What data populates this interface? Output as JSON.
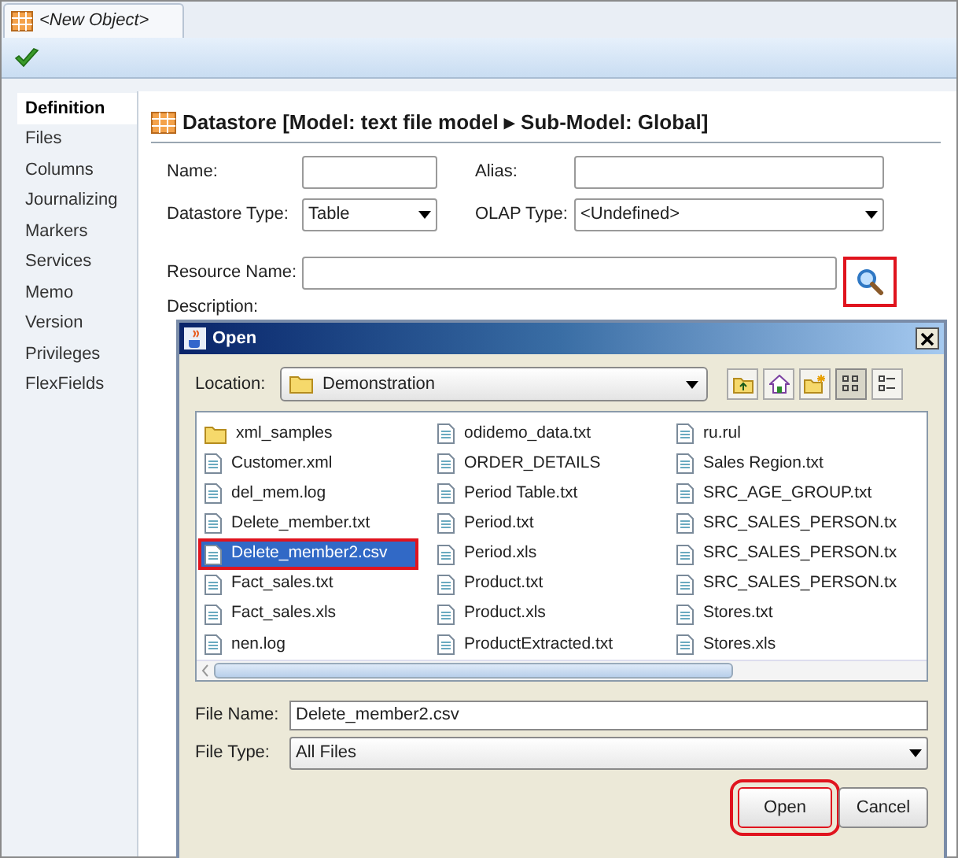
{
  "editor_tab": {
    "label": "<New Object>",
    "selected": true
  },
  "sidebar": {
    "items": [
      {
        "label": "Definition",
        "selected": true
      },
      {
        "label": "Files",
        "selected": false
      },
      {
        "label": "Columns",
        "selected": false
      },
      {
        "label": "Journalizing",
        "selected": false
      },
      {
        "label": "Markers",
        "selected": false
      },
      {
        "label": "Services",
        "selected": false
      },
      {
        "label": "Memo",
        "selected": false
      },
      {
        "label": "Version",
        "selected": false
      },
      {
        "label": "Privileges",
        "selected": false
      },
      {
        "label": "FlexFields",
        "selected": false
      }
    ]
  },
  "header": {
    "title": "Datastore [Model: text file model ▸ Sub-Model: Global]"
  },
  "form": {
    "name_label": "Name:",
    "alias_label": "Alias:",
    "datastore_type_label": "Datastore Type:",
    "datastore_type_value": "Table",
    "olap_type_label": "OLAP Type:",
    "olap_type_value": "<Undefined>",
    "resource_name_label": "Resource Name:",
    "search_button": {
      "highlighted": true
    },
    "description_label": "Description:"
  },
  "dialog": {
    "title": "Open",
    "location_label": "Location:",
    "location_value": "Demonstration",
    "files": [
      {
        "name": "xml_samples",
        "kind": "folder",
        "selected": false,
        "highlighted": false
      },
      {
        "name": "Customer.xml",
        "kind": "file",
        "selected": false,
        "highlighted": false
      },
      {
        "name": "del_mem.log",
        "kind": "file",
        "selected": false,
        "highlighted": false
      },
      {
        "name": "Delete_member.txt",
        "kind": "file",
        "selected": false,
        "highlighted": false
      },
      {
        "name": "Delete_member2.csv",
        "kind": "file",
        "selected": true,
        "highlighted": true
      },
      {
        "name": "Fact_sales.txt",
        "kind": "file",
        "selected": false,
        "highlighted": false
      },
      {
        "name": "Fact_sales.xls",
        "kind": "file",
        "selected": false,
        "highlighted": false
      },
      {
        "name": "nen.log",
        "kind": "file",
        "selected": false,
        "highlighted": false
      },
      {
        "name": "odidemo_data.txt",
        "kind": "file",
        "selected": false,
        "highlighted": false
      },
      {
        "name": "ORDER_DETAILS",
        "kind": "file",
        "selected": false,
        "highlighted": false
      },
      {
        "name": "Period Table.txt",
        "kind": "file",
        "selected": false,
        "highlighted": false
      },
      {
        "name": "Period.txt",
        "kind": "file",
        "selected": false,
        "highlighted": false
      },
      {
        "name": "Period.xls",
        "kind": "file",
        "selected": false,
        "highlighted": false
      },
      {
        "name": "Product.txt",
        "kind": "file",
        "selected": false,
        "highlighted": false
      },
      {
        "name": "Product.xls",
        "kind": "file",
        "selected": false,
        "highlighted": false
      },
      {
        "name": "ProductExtracted.txt",
        "kind": "file",
        "selected": false,
        "highlighted": false
      },
      {
        "name": "ru.rul",
        "kind": "file",
        "selected": false,
        "highlighted": false
      },
      {
        "name": "Sales Region.txt",
        "kind": "file",
        "selected": false,
        "highlighted": false
      },
      {
        "name": "SRC_AGE_GROUP.txt",
        "kind": "file",
        "selected": false,
        "highlighted": false
      },
      {
        "name": "SRC_SALES_PERSON.tx",
        "kind": "file",
        "selected": false,
        "highlighted": false
      },
      {
        "name": "SRC_SALES_PERSON.tx",
        "kind": "file",
        "selected": false,
        "highlighted": false
      },
      {
        "name": "SRC_SALES_PERSON.tx",
        "kind": "file",
        "selected": false,
        "highlighted": false
      },
      {
        "name": "Stores.txt",
        "kind": "file",
        "selected": false,
        "highlighted": false
      },
      {
        "name": "Stores.xls",
        "kind": "file",
        "selected": false,
        "highlighted": false
      }
    ],
    "file_name_label": "File Name:",
    "file_name_value": "Delete_member2.csv",
    "file_type_label": "File Type:",
    "file_type_value": "All Files",
    "buttons": [
      {
        "label": "Open",
        "highlighted": true
      },
      {
        "label": "Cancel",
        "highlighted": false
      }
    ]
  }
}
